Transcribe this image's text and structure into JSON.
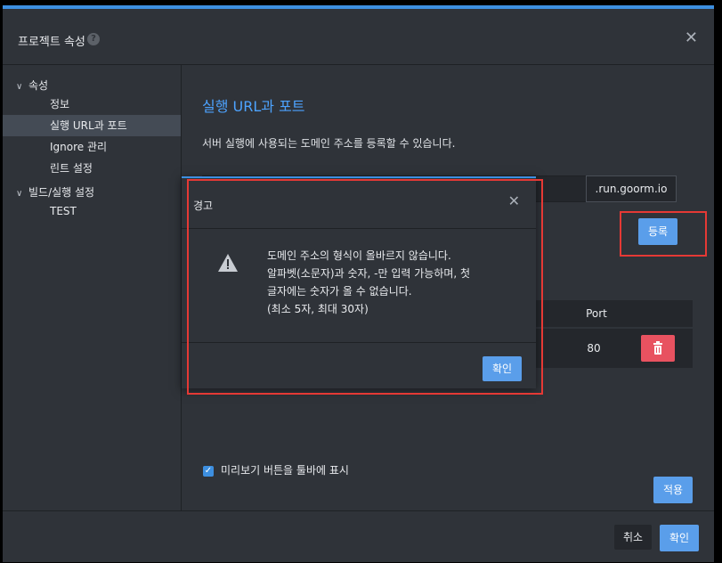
{
  "dialog": {
    "title": "프로젝트 속성",
    "help_icon": "?",
    "close_icon": "✕"
  },
  "sidebar": {
    "groups": [
      {
        "label": "속성",
        "items": [
          "정보",
          "실행 URL과 포트",
          "Ignore 관리",
          "린트 설정"
        ]
      },
      {
        "label": "빌드/실행 설정",
        "items": [
          "TEST"
        ]
      }
    ],
    "active_item": "실행 URL과 포트"
  },
  "content": {
    "title": "실행 URL과 포트",
    "description": "서버 실행에 사용되는 도메인 주소를 등록할 수 있습니다.",
    "domain_suffix": ".run.goorm.io",
    "register_button": "등록",
    "port_header": "Port",
    "port_value": "80",
    "checkbox_label": "미리보기 버튼을 툴바에 표시",
    "checkbox_checked": true,
    "apply_button": "적용"
  },
  "footer": {
    "cancel_button": "취소",
    "confirm_button": "확인"
  },
  "alert": {
    "title": "경고",
    "close_icon": "✕",
    "message_lines": [
      "도메인 주소의 형식이 올바르지 않습니다.",
      "알파벳(소문자)과 숫자, -만 입력 가능하며, 첫",
      "글자에는 숫자가 올 수 없습니다.",
      "(최소 5자, 최대 30자)"
    ],
    "confirm_button": "확인"
  },
  "colors": {
    "accent": "#3d8fe0",
    "button_blue": "#5a9eea",
    "danger": "#e85260",
    "highlight_outline": "#e53935"
  }
}
